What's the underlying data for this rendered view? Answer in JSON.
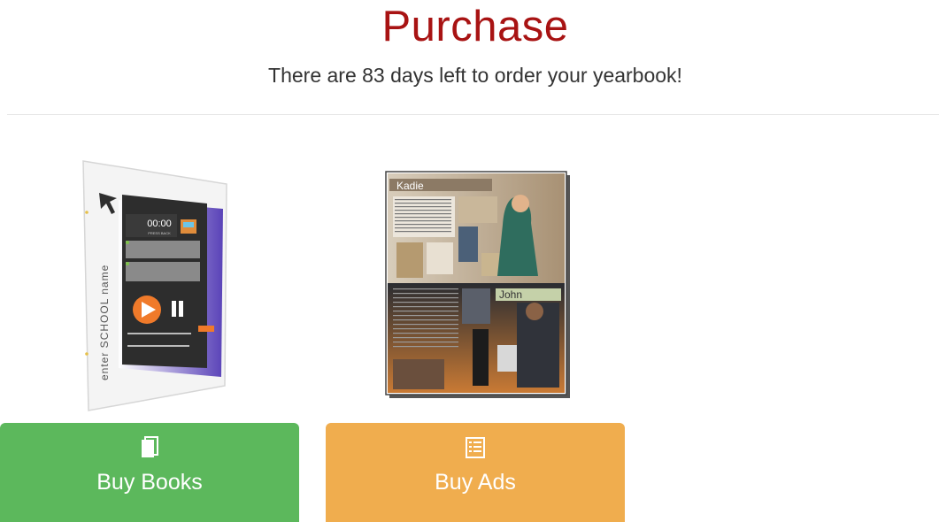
{
  "header": {
    "title": "Purchase",
    "subtitle": "There are 83 days left to order your yearbook!"
  },
  "products": {
    "books": {
      "button_label": "Buy Books",
      "icon": "book-icon",
      "color": "#5cb85c",
      "image_text": {
        "school_name": "enter SCHOOL name",
        "clock": "00:00",
        "clock_sub": "PRESS BACK"
      }
    },
    "ads": {
      "button_label": "Buy Ads",
      "icon": "list-icon",
      "color": "#f0ad4e",
      "image_text": {
        "name_top": "Kadie",
        "name_bottom": "John"
      }
    }
  },
  "colors": {
    "title": "#a81313",
    "subtitle": "#333333",
    "divider": "#e6e6e6"
  }
}
